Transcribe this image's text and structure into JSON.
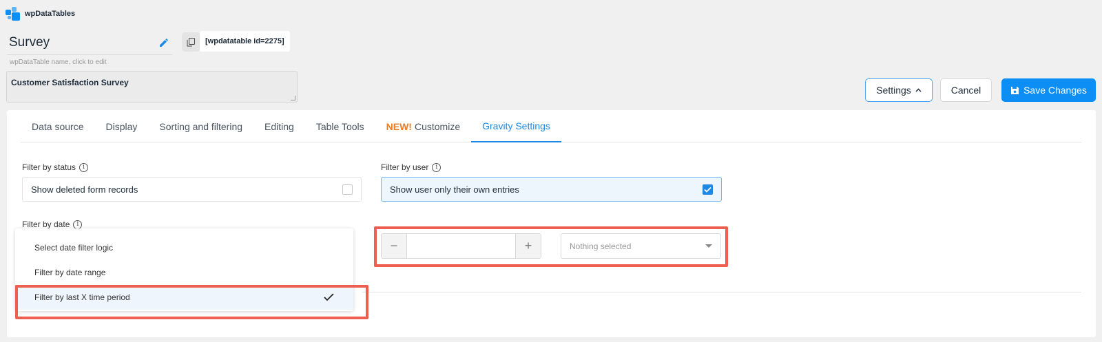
{
  "app": {
    "logo_text": "wpDataTables"
  },
  "table": {
    "name": "Survey",
    "name_hint": "wpDataTable name, click to edit",
    "shortcode": "[wpdatatable id=2275]",
    "description": "Customer Satisfaction Survey"
  },
  "toolbar": {
    "settings_label": "Settings",
    "cancel_label": "Cancel",
    "save_label": "Save Changes"
  },
  "tabs": [
    {
      "label": "Data source"
    },
    {
      "label": "Display"
    },
    {
      "label": "Sorting and filtering"
    },
    {
      "label": "Editing"
    },
    {
      "label": "Table Tools"
    },
    {
      "badge": "NEW!",
      "label": "Customize"
    },
    {
      "label": "Gravity Settings",
      "active": true
    }
  ],
  "filters": {
    "status": {
      "label": "Filter by status",
      "option_label": "Show deleted form records",
      "checked": false
    },
    "user": {
      "label": "Filter by user",
      "option_label": "Show user only their own entries",
      "checked": true
    },
    "date": {
      "label": "Filter by date",
      "options": [
        {
          "label": "Select date filter logic"
        },
        {
          "label": "Filter by date range"
        },
        {
          "label": "Filter by last X time period",
          "selected": true
        }
      ],
      "period_value": "",
      "period_unit_placeholder": "Nothing selected"
    }
  },
  "colors": {
    "accent": "#1e88e5",
    "save_button": "#0c8ef5",
    "new_badge": "#f07c22",
    "highlight_border": "#ee5f52"
  }
}
